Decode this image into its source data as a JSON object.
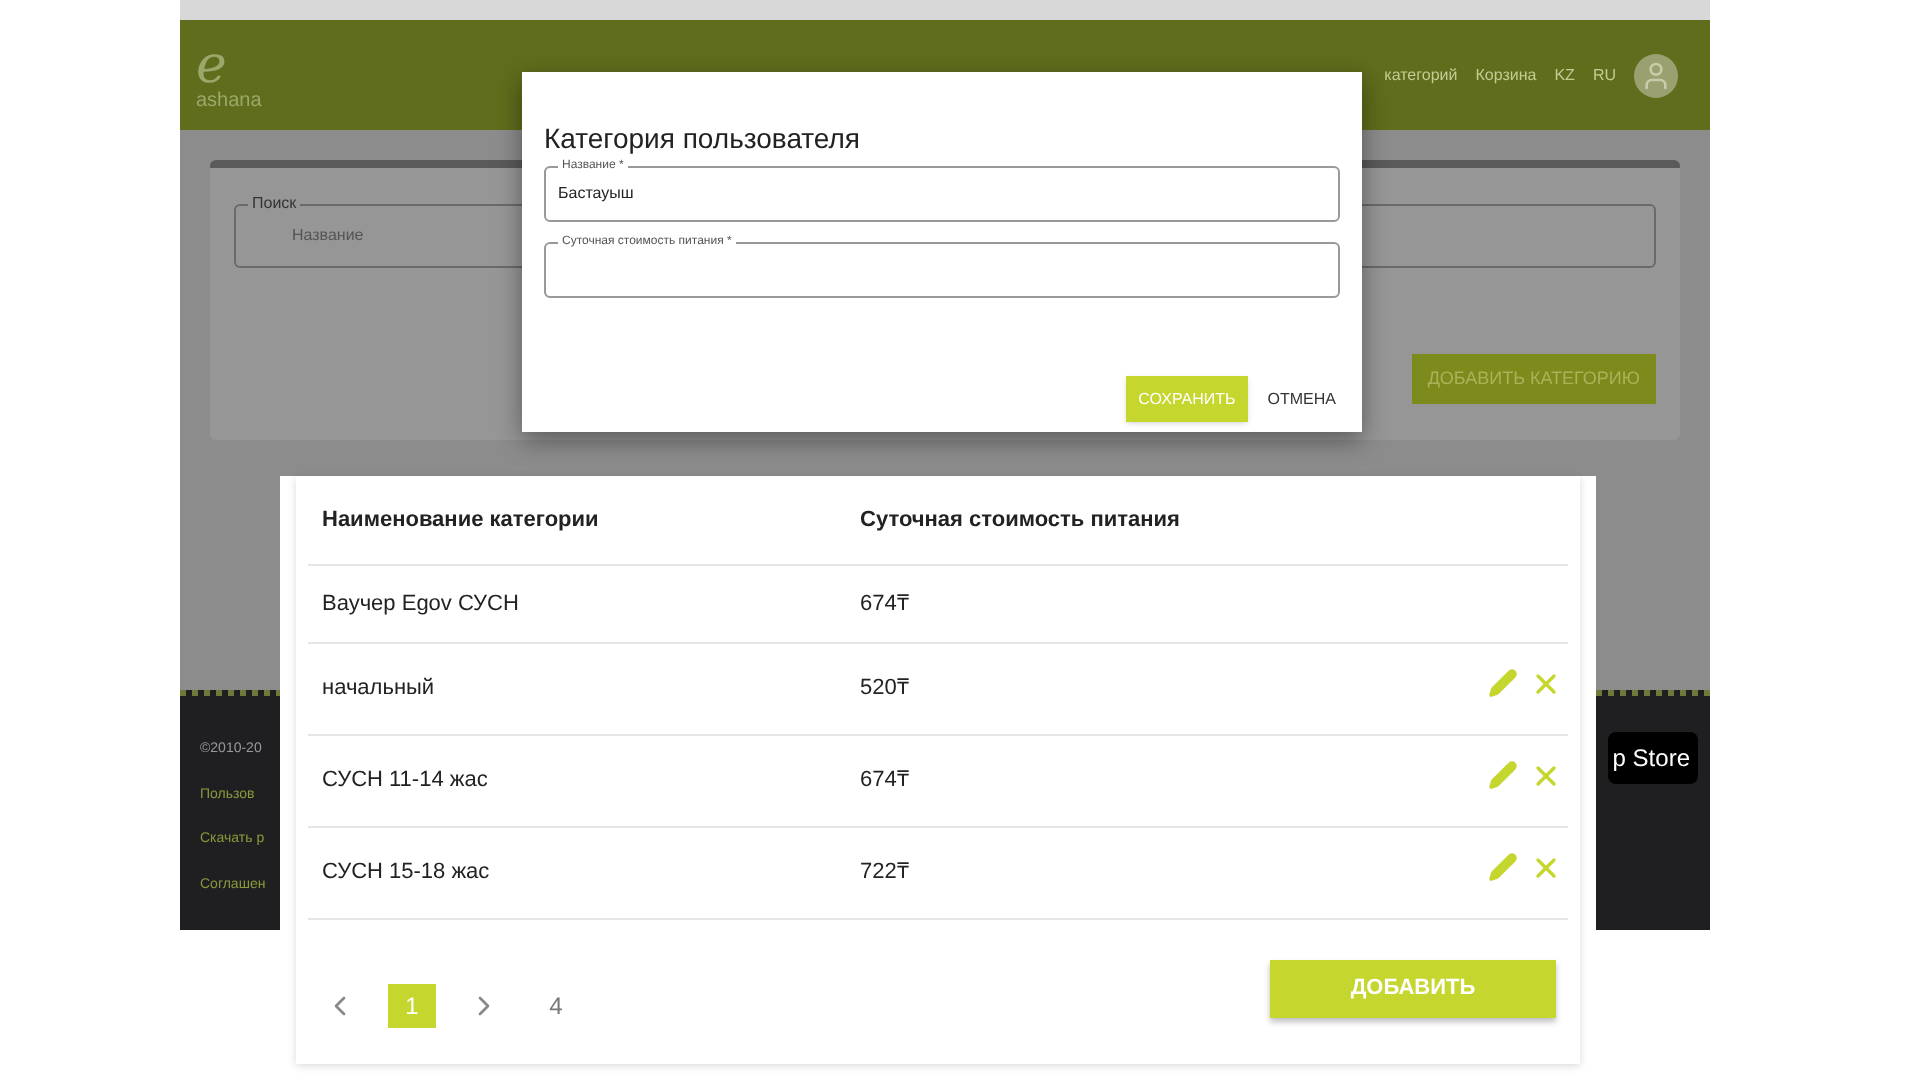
{
  "background_page": {
    "header": {
      "logo_mark": "e",
      "logo_text": "ashana",
      "nav": [
        "категорий",
        "Корзина",
        "KZ",
        "RU"
      ]
    },
    "search": {
      "legend": "Поиск",
      "placeholder": "Название"
    },
    "add_category_button": "ДОБАВИТЬ КАТЕГОРИЮ",
    "footer": {
      "copyright": "©2010-20",
      "links": [
        "Пользов",
        "Скачать р",
        "Соглашен"
      ],
      "store_badge": "p Store"
    }
  },
  "dialog": {
    "title": "Категория пользователя",
    "fields": [
      {
        "label": "Название *",
        "value": "Бастауыш"
      },
      {
        "label": "Суточная стоимость питания *"
      }
    ],
    "buttons": [
      {
        "label": "СОХРАНИТЬ",
        "kind": "primary"
      },
      {
        "label": "ОТМЕНА",
        "kind": "text"
      }
    ]
  },
  "table": {
    "columns": [
      "Наименование категории",
      "Суточная стоимость питания"
    ],
    "rows": [
      {
        "name": "Ваучер Egov СУСН",
        "cost": "674₸",
        "actions": false
      },
      {
        "name": "начальный",
        "cost": "520₸",
        "actions": true
      },
      {
        "name": "СУСН 11-14 жас",
        "cost": "674₸",
        "actions": true
      },
      {
        "name": "СУСН 15-18 жас",
        "cost": "722₸",
        "actions": true
      }
    ]
  },
  "pagination": [
    {
      "kind": "prev"
    },
    {
      "kind": "page",
      "label": "1",
      "selected": true
    },
    {
      "kind": "next"
    },
    {
      "kind": "page",
      "label": "4",
      "selected": false
    }
  ],
  "add_button": "ДОБАВИТЬ"
}
